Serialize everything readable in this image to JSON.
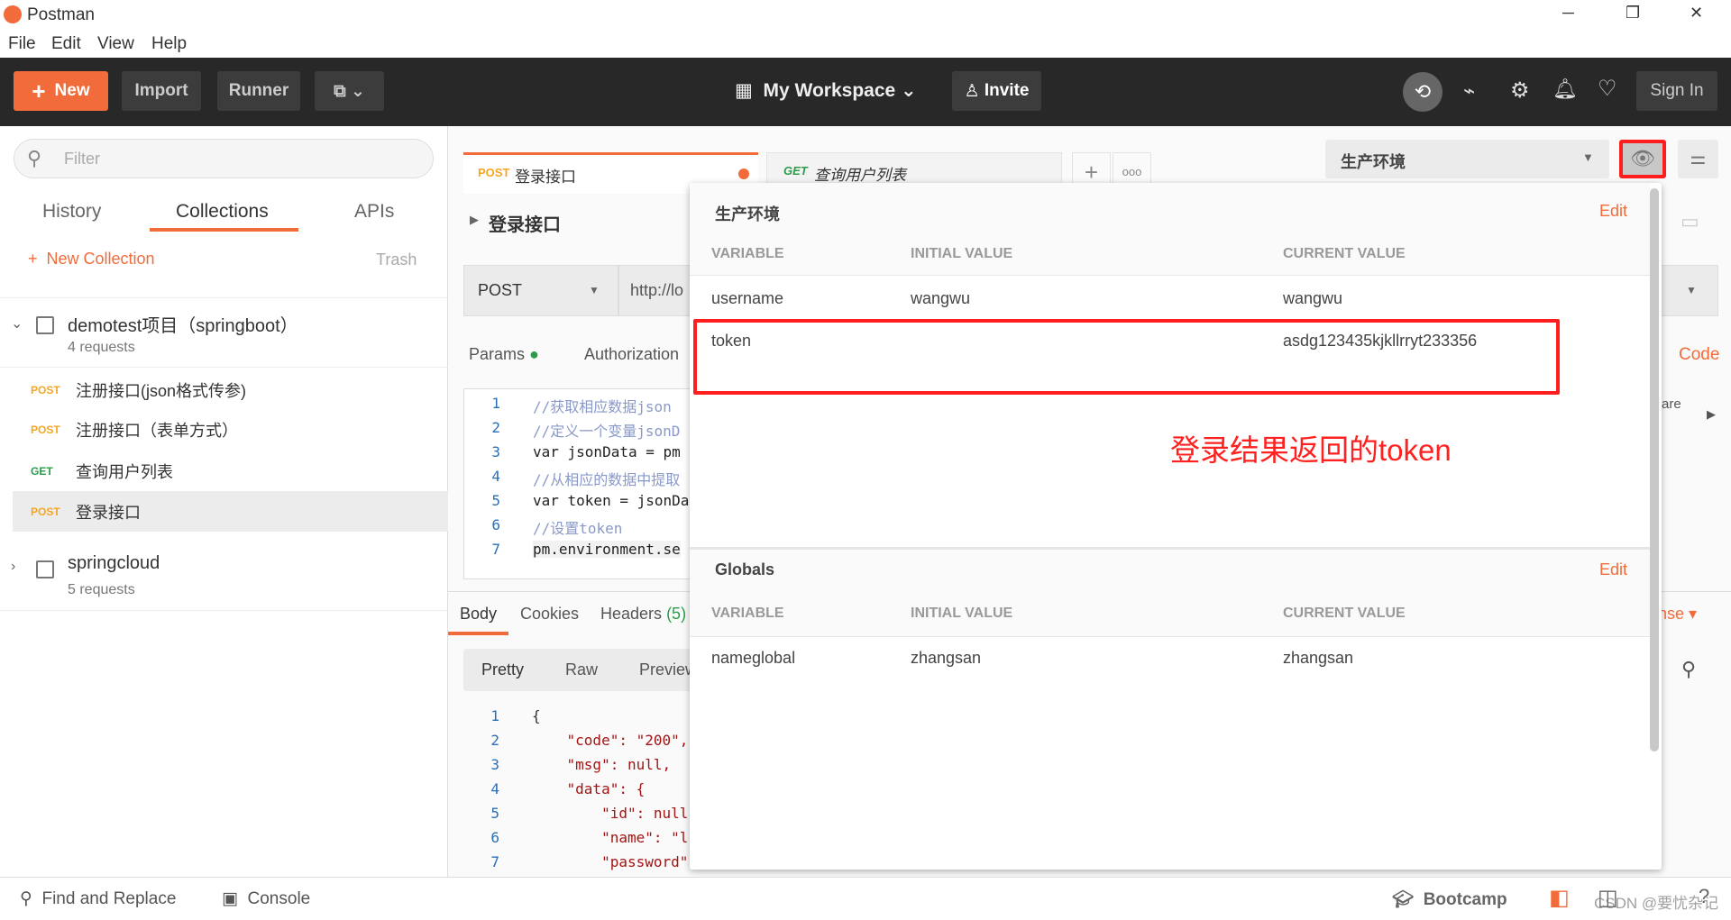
{
  "window": {
    "title": "Postman",
    "minimize": "─",
    "restore": "❐",
    "close": "✕"
  },
  "menu": [
    "File",
    "Edit",
    "View",
    "Help"
  ],
  "toolbar": {
    "new": "New",
    "import": "Import",
    "runner": "Runner",
    "workspace": "My Workspace",
    "invite": "Invite",
    "sign_in": "Sign In"
  },
  "sidebar": {
    "filter_placeholder": "Filter",
    "tabs": [
      "History",
      "Collections",
      "APIs"
    ],
    "new_collection": "New Collection",
    "trash": "Trash",
    "collections": [
      {
        "name": "demotest项目（springboot）",
        "count": "4 requests",
        "requests": [
          {
            "method": "POST",
            "name": "注册接口(json格式传参)"
          },
          {
            "method": "POST",
            "name": "注册接口（表单方式）"
          },
          {
            "method": "GET",
            "name": "查询用户列表"
          },
          {
            "method": "POST",
            "name": "登录接口"
          }
        ]
      },
      {
        "name": "springcloud",
        "count": "5 requests"
      }
    ]
  },
  "tabs": [
    {
      "method": "POST",
      "name": "登录接口"
    },
    {
      "method": "GET",
      "name": "查询用户列表"
    }
  ],
  "request": {
    "name": "登录接口",
    "method": "POST",
    "url": "http://lo",
    "params": "Params",
    "authorization": "Authorization",
    "code": "Code",
    "share": "are",
    "script": [
      "//获取相应数据json",
      "//定义一个变量jsonD",
      "var jsonData = pm",
      "//从相应的数据中提取",
      "var token = jsonDa",
      "//设置token",
      "pm.environment.se"
    ]
  },
  "response": {
    "tabs": [
      "Body",
      "Cookies",
      "Headers",
      "(5)"
    ],
    "views": [
      "Pretty",
      "Raw",
      "Preview"
    ],
    "response_label": "nse",
    "lines": [
      "{",
      "    \"code\": \"200\",",
      "    \"msg\": null,",
      "    \"data\": {",
      "        \"id\": null",
      "        \"name\": \"l",
      "        \"password\""
    ]
  },
  "environment": {
    "selected": "生产环境",
    "popup": {
      "env_title": "生产环境",
      "edit": "Edit",
      "headers": [
        "VARIABLE",
        "INITIAL VALUE",
        "CURRENT VALUE"
      ],
      "env_vars": [
        {
          "variable": "username",
          "initial": "wangwu",
          "current": "wangwu"
        },
        {
          "variable": "token",
          "initial": "",
          "current": "asdg123435kjkllrryt233356"
        }
      ],
      "globals_title": "Globals",
      "globals": [
        {
          "variable": "nameglobal",
          "initial": "zhangsan",
          "current": "zhangsan"
        }
      ]
    }
  },
  "annotation": "登录结果返回的token",
  "statusbar": {
    "find_replace": "Find and Replace",
    "console": "Console",
    "bootcamp": "Bootcamp"
  },
  "watermark": "CSDN @要忧杂记",
  "colors": {
    "accent": "#f26b3a",
    "post": "#f5a623",
    "get": "#2a9d4a",
    "annotation": "#ff2020"
  }
}
